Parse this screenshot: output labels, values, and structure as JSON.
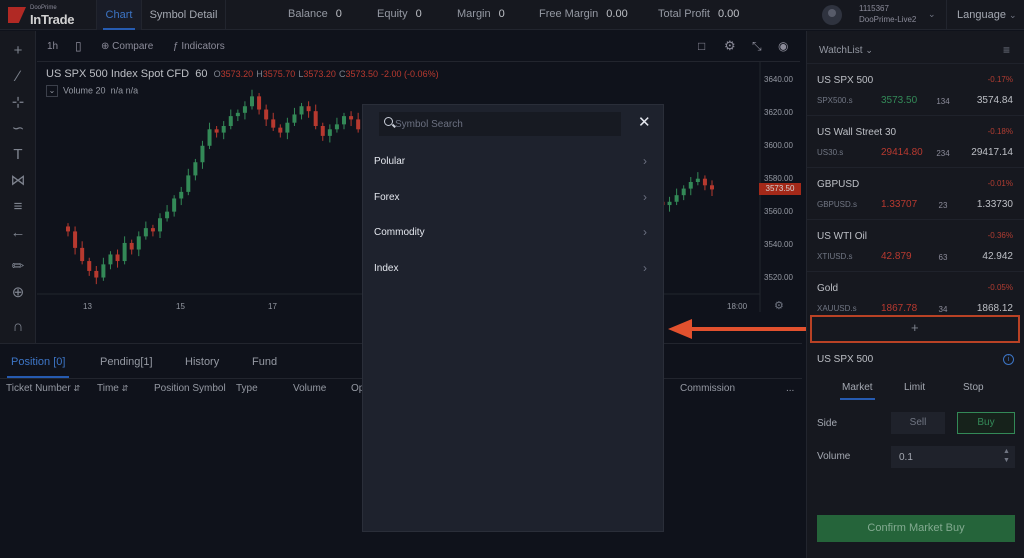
{
  "brand": {
    "small": "DooPrime",
    "name": "InTrade"
  },
  "nav": {
    "tabs": [
      "Chart",
      "Symbol Detail"
    ]
  },
  "stats": [
    {
      "label": "Balance",
      "value": "0"
    },
    {
      "label": "Equity",
      "value": "0"
    },
    {
      "label": "Margin",
      "value": "0"
    },
    {
      "label": "Free Margin",
      "value": "0.00"
    },
    {
      "label": "Total Profit",
      "value": "0.00"
    }
  ],
  "account": {
    "id": "1115367",
    "server": "DooPrime-Live2"
  },
  "language": "Language",
  "chart_toolbar": {
    "interval": "1h",
    "compare": "Compare",
    "indicators": "Indicators"
  },
  "chart": {
    "symbol_title": "US SPX 500 Index Spot CFD",
    "interval_num": "60",
    "ohlc": [
      {
        "k": "O",
        "v": "3573.20"
      },
      {
        "k": "H",
        "v": "3575.70"
      },
      {
        "k": "L",
        "v": "3573.20"
      },
      {
        "k": "C",
        "v": "3573.50"
      }
    ],
    "change": "-2.00 (-0.06%)",
    "volume_label": "Volume",
    "volume_len": "20",
    "volume_vals": "n/a n/a",
    "last_price": "3573.50"
  },
  "chart_data": {
    "type": "candlestick",
    "y_ticks": [
      "3640.00",
      "3620.00",
      "3600.00",
      "3580.00",
      "3560.00",
      "3540.00",
      "3520.00"
    ],
    "x_ticks": [
      "13",
      "15",
      "17",
      "18:00"
    ],
    "ylim": [
      3510,
      3646
    ],
    "closes": [
      3548,
      3538,
      3530,
      3524,
      3520,
      3528,
      3534,
      3530,
      3541,
      3537,
      3545,
      3550,
      3548,
      3556,
      3560,
      3568,
      3572,
      3582,
      3590,
      3600,
      3610,
      3608,
      3612,
      3618,
      3620,
      3624,
      3630,
      3622,
      3616,
      3611,
      3608,
      3614,
      3619,
      3624,
      3621,
      3612,
      3606,
      3610,
      3613,
      3618,
      3616,
      3610,
      3606,
      3600,
      3604,
      3610,
      3606,
      3612,
      3606,
      3598,
      3594,
      3602,
      3610,
      3614,
      3618,
      3612,
      3606,
      3600,
      3597,
      3599,
      3602,
      3605,
      3600,
      3596,
      3592,
      3596,
      3600,
      3604,
      3608,
      3604,
      3600,
      3596,
      3592,
      3590,
      3594,
      3590,
      3586,
      3582,
      3578,
      3575,
      3572,
      3570,
      3568,
      3566,
      3564,
      3566,
      3570,
      3574,
      3578,
      3580,
      3576,
      3573.5
    ]
  },
  "bottom": {
    "tabs": [
      "Position [0]",
      "Pending[1]",
      "History",
      "Fund"
    ],
    "columns": [
      "Ticket Number",
      "Time",
      "Position Symbol",
      "Type",
      "Volume",
      "Op",
      "Commission",
      "..."
    ]
  },
  "watchlist": {
    "title": "WatchList",
    "items": [
      {
        "name": "US SPX 500",
        "pct": "-0.17%",
        "sym": "SPX500.s",
        "bid": "3573.50",
        "spread": "134",
        "ask": "3574.84",
        "dir": "up"
      },
      {
        "name": "US Wall Street 30",
        "pct": "-0.18%",
        "sym": "US30.s",
        "bid": "29414.80",
        "spread": "234",
        "ask": "29417.14",
        "dir": "dn"
      },
      {
        "name": "GBPUSD",
        "pct": "-0.01%",
        "sym": "GBPUSD.s",
        "bid": "1.33707",
        "spread": "23",
        "ask": "1.33730",
        "dir": "dn"
      },
      {
        "name": "US WTI Oil",
        "pct": "-0.36%",
        "sym": "XTIUSD.s",
        "bid": "42.879",
        "spread": "63",
        "ask": "42.942",
        "dir": "dn"
      },
      {
        "name": "Gold",
        "pct": "-0.05%",
        "sym": "XAUUSD.s",
        "bid": "1867.78",
        "spread": "34",
        "ask": "1868.12",
        "dir": "dn"
      }
    ],
    "add_label": "+"
  },
  "order": {
    "symbol": "US SPX 500",
    "info": "i",
    "tabs": [
      "Market",
      "Limit",
      "Stop"
    ],
    "side_label": "Side",
    "sell": "Sell",
    "buy": "Buy",
    "volume_label": "Volume",
    "volume_value": "0.1",
    "confirm": "Confirm Market Buy"
  },
  "dialog": {
    "search_placeholder": "Symbol Search",
    "close": "✕",
    "categories": [
      "Polular",
      "Forex",
      "Commodity",
      "Index"
    ]
  },
  "colors": {
    "accent": "#2f6fd8",
    "up": "#3fa86b",
    "down": "#e0463a",
    "annotation": "#e2512e"
  }
}
